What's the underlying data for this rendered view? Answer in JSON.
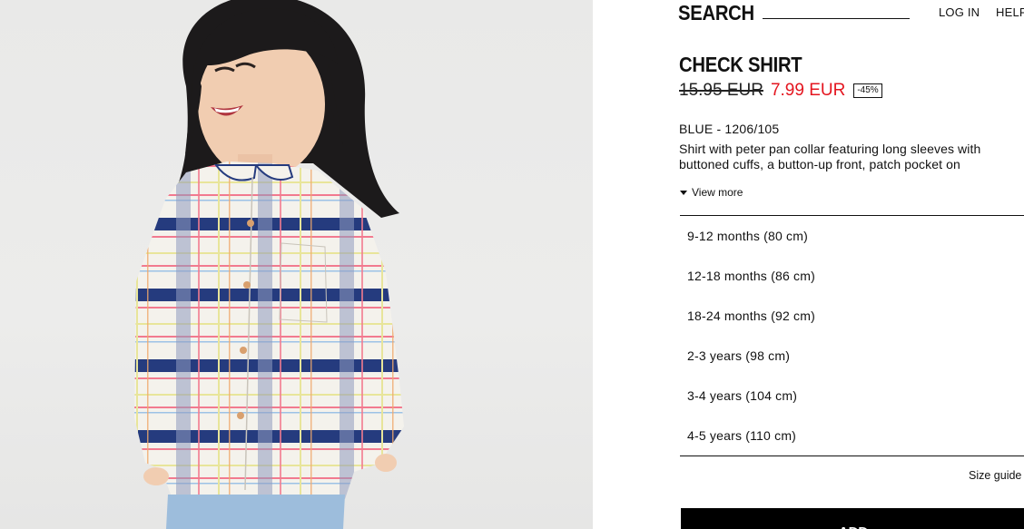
{
  "header": {
    "search_label": "SEARCH",
    "login_label": "LOG IN",
    "help_label": "HELP"
  },
  "product": {
    "title": "CHECK SHIRT",
    "price_original": "15.95 EUR",
    "price_sale": "7.99 EUR",
    "discount": "-45%",
    "color_ref": "BLUE - 1206/105",
    "description_lines": [
      "Shirt with peter pan collar featuring long sleeves with",
      "buttoned cuffs, a button-up front, patch pocket on"
    ],
    "view_more_label": "View more",
    "image_subject": "child-in-check-shirt"
  },
  "sizes": [
    {
      "label": "9-12 months (80 cm)"
    },
    {
      "label": "12-18 months (86 cm)"
    },
    {
      "label": "18-24 months (92 cm)"
    },
    {
      "label": "2-3 years (98 cm)"
    },
    {
      "label": "3-4 years (104 cm)"
    },
    {
      "label": "4-5 years (110 cm)"
    }
  ],
  "size_guide_label": "Size guide",
  "add_label": "ADD",
  "colors": {
    "sale_price": "#e4151f",
    "button_bg": "#000000",
    "image_bg": "#eaeae9",
    "check_navy": "#253b7e",
    "check_pink": "#f27a8f",
    "check_yellow": "#e8e59a"
  }
}
